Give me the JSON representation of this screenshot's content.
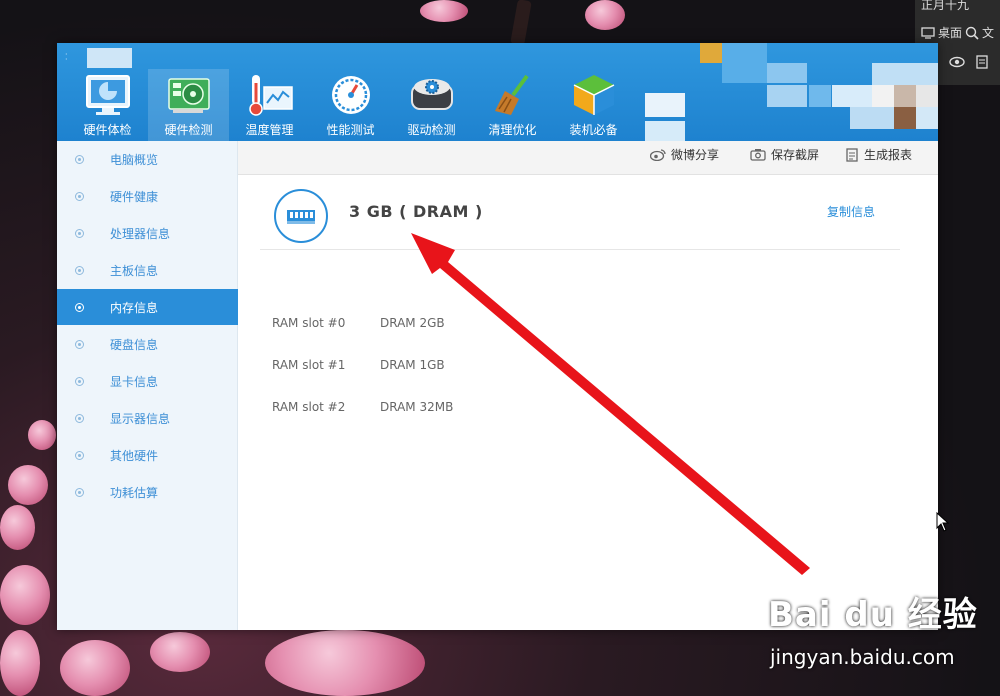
{
  "desktop": {
    "top_text": "正月十九",
    "desktop_label": "桌面",
    "file_label": "文"
  },
  "nav": {
    "items": [
      {
        "label": "硬件体检",
        "icon": "monitor-icon"
      },
      {
        "label": "硬件检测",
        "icon": "hardware-card-icon",
        "active": true
      },
      {
        "label": "温度管理",
        "icon": "thermometer-icon"
      },
      {
        "label": "性能测试",
        "icon": "gauge-icon"
      },
      {
        "label": "驱动检测",
        "icon": "driver-gear-icon"
      },
      {
        "label": "清理优化",
        "icon": "broom-icon"
      },
      {
        "label": "装机必备",
        "icon": "cube-icon"
      }
    ]
  },
  "sidebar": {
    "items": [
      {
        "label": "电脑概览"
      },
      {
        "label": "硬件健康"
      },
      {
        "label": "处理器信息"
      },
      {
        "label": "主板信息"
      },
      {
        "label": "内存信息",
        "active": true
      },
      {
        "label": "硬盘信息"
      },
      {
        "label": "显卡信息"
      },
      {
        "label": "显示器信息"
      },
      {
        "label": "其他硬件"
      },
      {
        "label": "功耗估算"
      }
    ]
  },
  "toolbar": {
    "weibo_label": "微博分享",
    "screenshot_label": "保存截屏",
    "report_label": "生成报表"
  },
  "memory": {
    "title": "3 GB ( DRAM )",
    "copy_label": "复制信息",
    "slots": [
      {
        "name": "RAM slot #0",
        "value": "DRAM 2GB"
      },
      {
        "name": "RAM slot #1",
        "value": "DRAM 1GB"
      },
      {
        "name": "RAM slot #2",
        "value": "DRAM 32MB"
      }
    ]
  },
  "watermark": {
    "brand": "Bai du 经验",
    "url": "jingyan.baidu.com"
  },
  "colors": {
    "accent": "#2a8ed9",
    "header": "#1e82cf",
    "arrow": "#e8141a"
  }
}
